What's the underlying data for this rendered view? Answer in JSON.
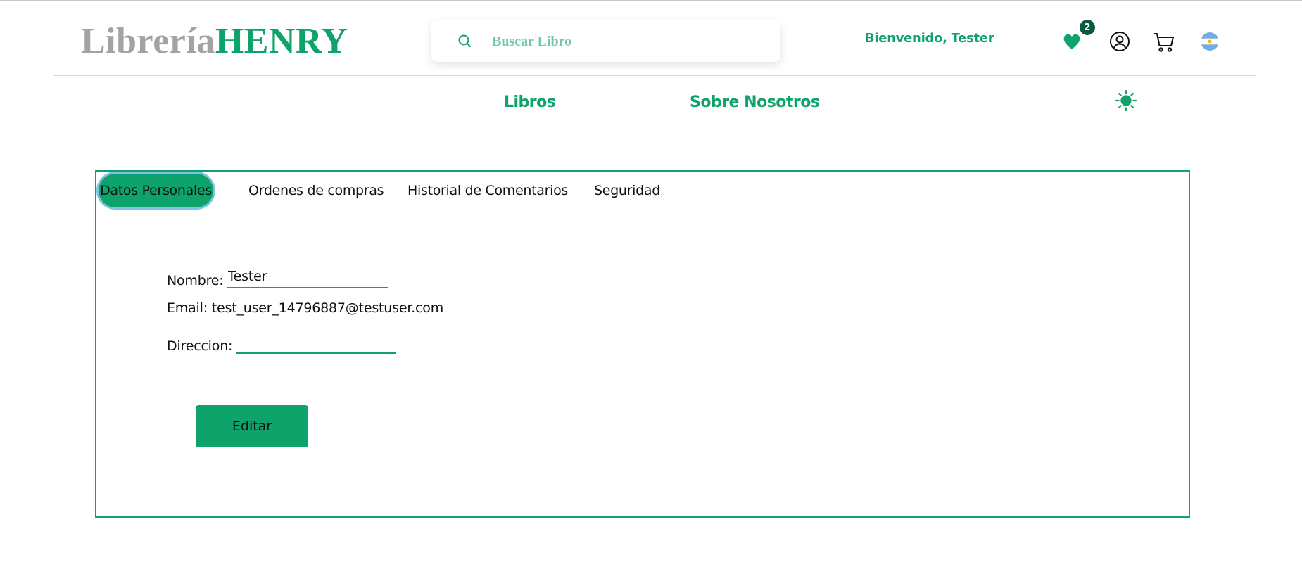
{
  "brand": {
    "part1": "Librería",
    "part2": "HENRY"
  },
  "search": {
    "placeholder": "Buscar Libro",
    "value": ""
  },
  "header": {
    "welcome": "Bienvenido, Tester",
    "favorites_count": "2",
    "icons": [
      "search-icon",
      "heart-icon",
      "user-icon",
      "cart-icon",
      "argentina-flag-icon",
      "sun-icon"
    ]
  },
  "nav": {
    "libros": "Libros",
    "sobre_nosotros": "Sobre Nosotros"
  },
  "profile": {
    "tabs": [
      {
        "label": "Datos Personales",
        "active": true
      },
      {
        "label": "Ordenes de compras",
        "active": false
      },
      {
        "label": "Historial de Comentarios",
        "active": false
      },
      {
        "label": "Seguridad",
        "active": false
      }
    ],
    "nombre_label": "Nombre:",
    "nombre_value": "Tester",
    "email_label": "Email:",
    "email_value": "test_user_14796887@testuser.com",
    "direccion_label": "Direccion:",
    "direccion_value": "",
    "edit_label": "Editar"
  },
  "colors": {
    "accent": "#0ea36b",
    "logo_gray": "#a3a3a3",
    "badge": "#0b5a3c",
    "panel_border": "#129e6d"
  }
}
